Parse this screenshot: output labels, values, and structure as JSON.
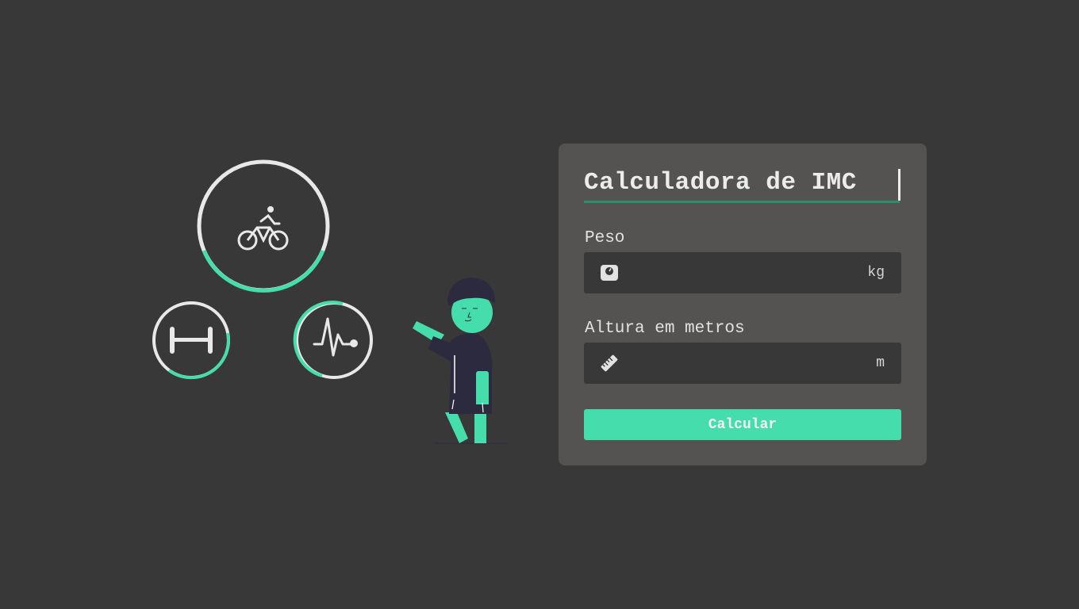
{
  "form": {
    "title": "Calculadora de IMC",
    "weight_label": "Peso",
    "weight_value": "",
    "weight_unit": "kg",
    "height_label": "Altura em metros",
    "height_value": "",
    "height_unit": "m",
    "submit_label": "Calcular"
  },
  "illustration": {
    "icons": [
      "bicycle-icon",
      "dumbbell-icon",
      "heartbeat-icon"
    ],
    "progress": {
      "bicycle": 0.32,
      "dumbbell": 0.5,
      "heartbeat": 0.6
    }
  },
  "colors": {
    "background": "#383838",
    "card": "#545351",
    "accent": "#45ddab",
    "underline": "#2f8d6a",
    "ring": "#e8e8e8",
    "figure_dark": "#2b2a3e"
  }
}
